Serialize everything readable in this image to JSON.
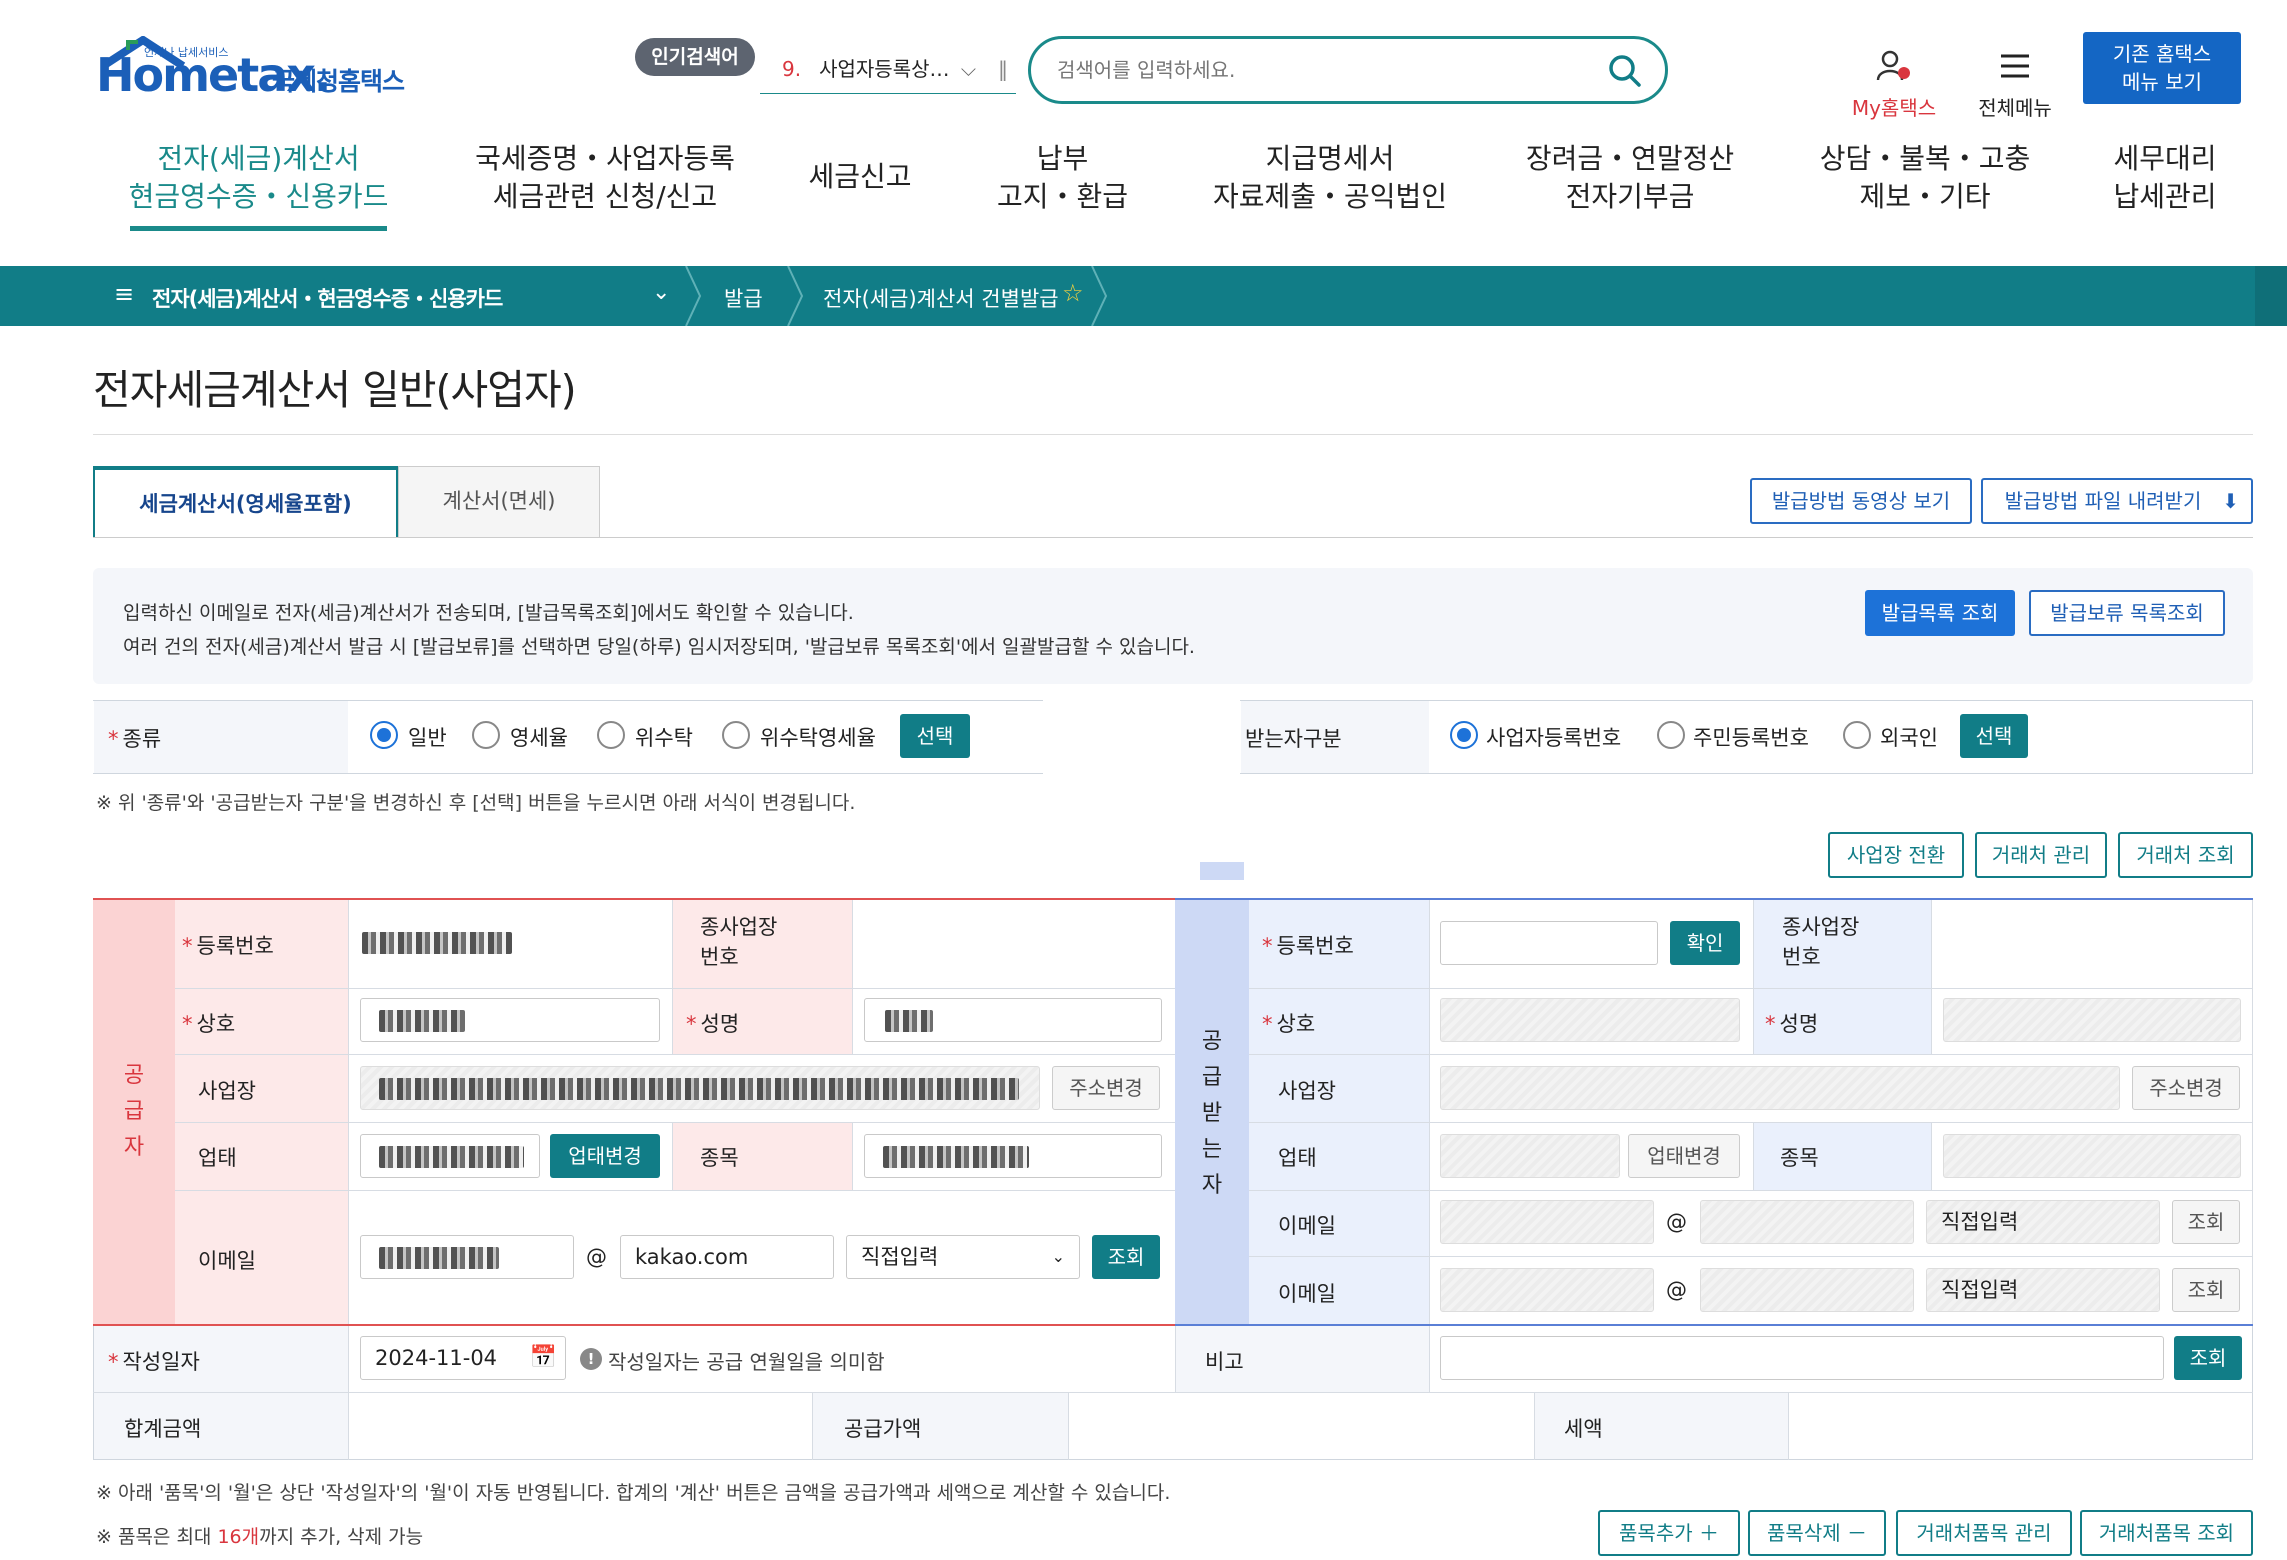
{
  "header": {
    "logo_small": "언제나 납세서비스",
    "logo_text": "Hometax.",
    "logo_kr": "국세청홈택스",
    "popular_label": "인기검색어",
    "popular_rank": "9.",
    "popular_term": "사업자등록상…",
    "search_placeholder": "검색어를 입력하세요.",
    "my_hometax": "My홈택스",
    "all_menu": "전체메뉴",
    "old_menu_line1": "기존 홈택스",
    "old_menu_line2": "메뉴 보기"
  },
  "gnb": [
    {
      "line1": "전자(세금)계산서",
      "line2": "현금영수증・신용카드"
    },
    {
      "line1": "국세증명・사업자등록",
      "line2": "세금관련 신청/신고"
    },
    {
      "line1": "세금신고",
      "line2": ""
    },
    {
      "line1": "납부",
      "line2": "고지・환급"
    },
    {
      "line1": "지급명세서",
      "line2": "자료제출・공익법인"
    },
    {
      "line1": "장려금・연말정산",
      "line2": "전자기부금"
    },
    {
      "line1": "상담・불복・고충",
      "line2": "제보・기타"
    },
    {
      "line1": "세무대리",
      "line2": "납세관리"
    }
  ],
  "breadcrumb": {
    "menu": "전자(세금)계산서・현금영수증・신용카드",
    "level2": "발급",
    "level3": "전자(세금)계산서 건별발급"
  },
  "page": {
    "title": "전자세금계산서 일반(사업자)",
    "tab_active": "세금계산서(영세율포함)",
    "tab_inactive": "계산서(면세)",
    "btn_video": "발급방법 동영상 보기",
    "btn_download": "발급방법 파일 내려받기",
    "notice_line1": "입력하신 이메일로 전자(세금)계산서가 전송되며, [발급목록조회]에서도 확인할 수 있습니다.",
    "notice_line2": "여러 건의 전자(세금)계산서 발급 시 [발급보류]를 선택하면 당일(하루) 임시저장되며, '발급보류 목록조회'에서 일괄발급할 수 있습니다.",
    "btn_issue_list": "발급목록 조회",
    "btn_hold_list": "발급보류 목록조회"
  },
  "kind": {
    "label": "종류",
    "options": [
      "일반",
      "영세율",
      "위수탁",
      "위수탁영세율"
    ],
    "selected": "일반",
    "select_btn": "선택",
    "receiver_label": "받는자구분",
    "receiver_options": [
      "사업자등록번호",
      "주민등록번호",
      "외국인"
    ],
    "receiver_selected": "사업자등록번호",
    "note": "※ 위 '종류'와 '공급받는자 구분'을 변경하신 후 [선택] 버튼을 누르시면 아래 서식이 변경됩니다."
  },
  "actions": {
    "switch_place": "사업장 전환",
    "manage_partner": "거래처 관리",
    "lookup_partner": "거래처 조회"
  },
  "supplier": {
    "side_label": "공급자",
    "reg_no_label": "등록번호",
    "branch_label_1": "종사업장",
    "branch_label_2": "번호",
    "name_label": "상호",
    "rep_label": "성명",
    "address_label": "사업장",
    "address_btn": "주소변경",
    "biz_type_label": "업태",
    "biz_type_btn": "업태변경",
    "item_label": "종목",
    "email_label": "이메일",
    "email_domain": "kakao.com",
    "email_select": "직접입력",
    "email_lookup": "조회"
  },
  "buyer": {
    "side_label": "공급받는자",
    "reg_no_label": "등록번호",
    "confirm_btn": "확인",
    "branch_label_1": "종사업장",
    "branch_label_2": "번호",
    "name_label": "상호",
    "rep_label": "성명",
    "address_label": "사업장",
    "address_btn": "주소변경",
    "biz_type_label": "업태",
    "biz_type_btn": "업태변경",
    "item_label": "종목",
    "email_label_1": "이메일",
    "email_label_2": "이메일",
    "email_select": "직접입력",
    "email_lookup": "조회"
  },
  "footer_rows": {
    "date_label": "작성일자",
    "date_value": "2024-11-04",
    "date_hint": "작성일자는 공급 연월일을 의미함",
    "remark_label": "비고",
    "remark_lookup": "조회",
    "total_label": "합계금액",
    "supply_label": "공급가액",
    "tax_label": "세액"
  },
  "bottom": {
    "note1": "※ 아래 '품목'의 '월'은 상단 '작성일자'의 '월'이 자동 반영됩니다. 합계의 '계산' 버튼은 금액을 공급가액과 세액으로 계산할 수 있습니다.",
    "note2_prefix": "※ 품목은 최대 ",
    "note2_count": "16개",
    "note2_suffix": "까지 추가, 삭제 가능",
    "add_item": "품목추가",
    "del_item": "품목삭제",
    "manage_items": "거래처품목 관리",
    "lookup_items": "거래처품목 조회"
  },
  "colors": {
    "teal": "#117d87",
    "blue": "#1d72d8",
    "supplier_pink": "#fbd3d3",
    "buyer_blue": "#cdd9f5",
    "required_red": "#d9363e"
  }
}
